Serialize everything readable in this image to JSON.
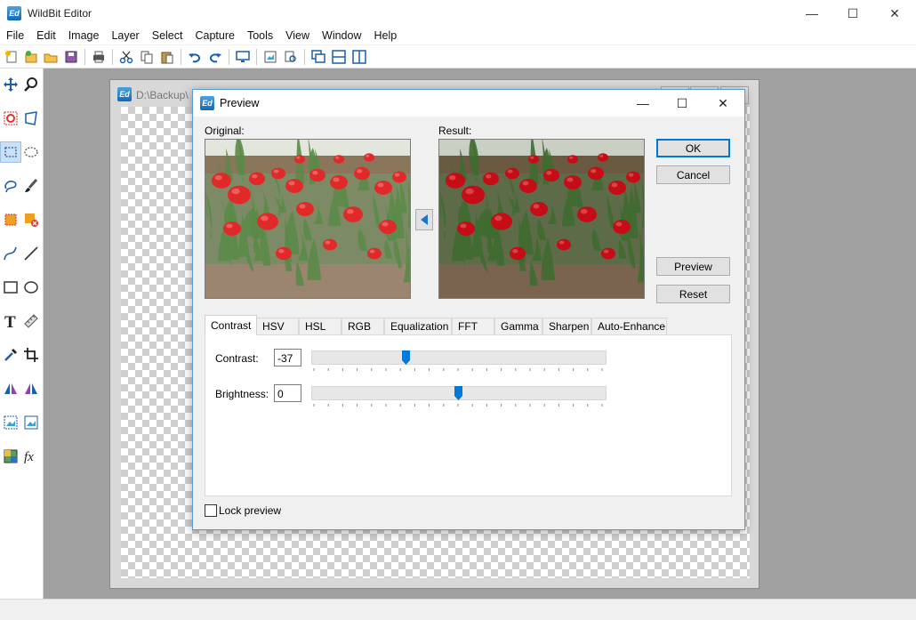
{
  "app": {
    "icon_text": "Ed",
    "title": "WildBit Editor"
  },
  "window_controls": {
    "minimize": "—",
    "maximize": "☐",
    "close": "✕"
  },
  "menu": [
    "File",
    "Edit",
    "Image",
    "Layer",
    "Select",
    "Capture",
    "Tools",
    "View",
    "Window",
    "Help"
  ],
  "toolbar_icons": [
    "new-icon",
    "open-icon",
    "open-folder-icon",
    "save-icon",
    "print-icon",
    "cut-icon",
    "copy-icon",
    "paste-icon",
    "undo-icon",
    "redo-icon",
    "monitor-icon",
    "image-properties-icon",
    "search-image-icon",
    "cascade-icon",
    "tile-horizontal-icon",
    "tile-vertical-icon"
  ],
  "tools": [
    "move-tool",
    "zoom-tool",
    "crop-circle-tool",
    "transform-tool",
    "rect-select-tool",
    "ellipse-select-tool",
    "lasso-tool",
    "brush-tool",
    "fill-tool",
    "erase-fill-tool",
    "curve-tool",
    "line-tool",
    "rectangle-tool",
    "ellipse-tool",
    "text-tool",
    "ruler-tool",
    "eyedropper-tool",
    "crop-tool",
    "mirror-tool",
    "flip-tool",
    "resize-tool",
    "rotate-tool",
    "color-balance-tool",
    "effects-tool"
  ],
  "document": {
    "title": "D:\\Backup\\"
  },
  "dialog": {
    "icon_text": "Ed",
    "title": "Preview",
    "original_label": "Original:",
    "result_label": "Result:",
    "buttons": {
      "ok": "OK",
      "cancel": "Cancel",
      "preview": "Preview",
      "reset": "Reset"
    },
    "tabs": [
      "Contrast",
      "HSV",
      "HSL",
      "RGB",
      "Equalization",
      "FFT",
      "Gamma",
      "Sharpen",
      "Auto-Enhance"
    ],
    "selected_tab": "Contrast",
    "contrast": {
      "label": "Contrast:",
      "value": "-37",
      "slider_fraction": 0.32
    },
    "brightness": {
      "label": "Brightness:",
      "value": "0",
      "slider_fraction": 0.5
    },
    "lock_preview": {
      "label": "Lock preview",
      "checked": false
    }
  },
  "colors": {
    "accent": "#0078d7",
    "workspace": "#a0a0a0",
    "tulip_red": "#d8131c",
    "foliage": "#4f7f3c"
  }
}
